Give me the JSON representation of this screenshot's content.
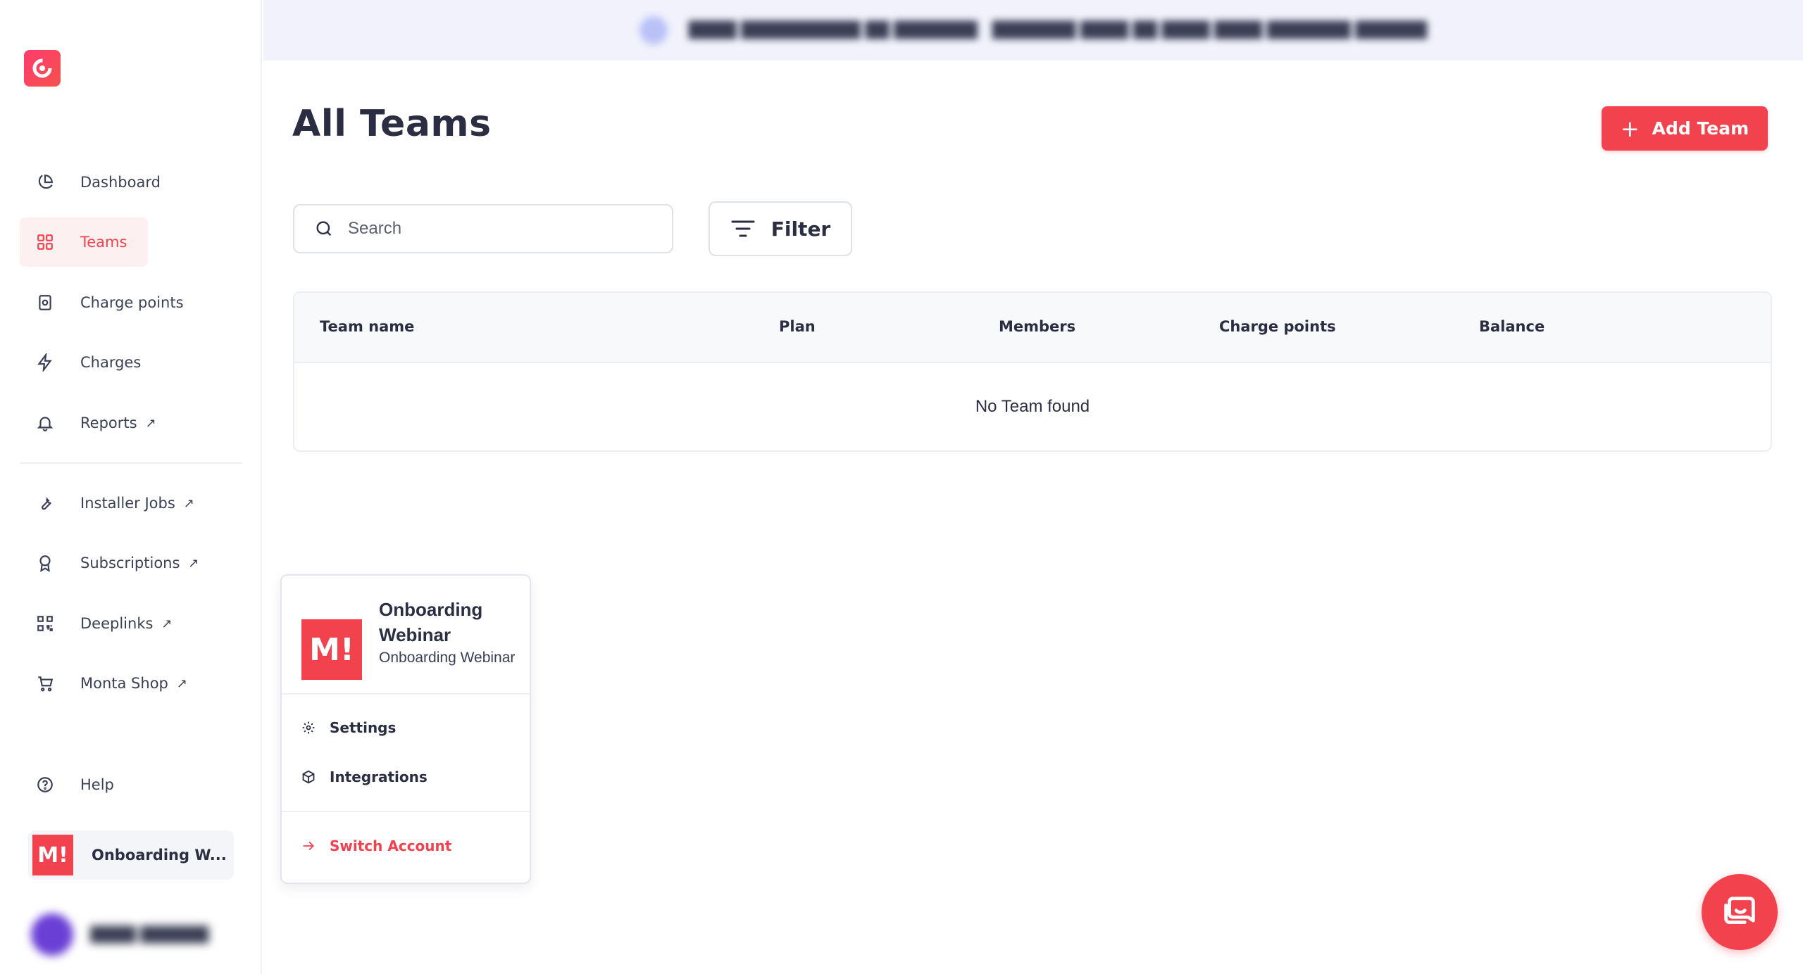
{
  "sidebar": {
    "items": [
      {
        "label": "Dashboard",
        "icon": "pie-chart-icon"
      },
      {
        "label": "Teams",
        "icon": "grid-icon",
        "active": true
      },
      {
        "label": "Charge points",
        "icon": "charger-icon"
      },
      {
        "label": "Charges",
        "icon": "bolt-icon"
      },
      {
        "label": "Reports",
        "icon": "bell-icon",
        "external": true
      },
      {
        "label": "Installer Jobs",
        "icon": "wrench-icon",
        "external": true
      },
      {
        "label": "Subscriptions",
        "icon": "award-icon",
        "external": true
      },
      {
        "label": "Deeplinks",
        "icon": "qr-code-icon",
        "external": true
      },
      {
        "label": "Monta Shop",
        "icon": "cart-icon",
        "external": true
      },
      {
        "label": "Help",
        "icon": "help-circle-icon"
      }
    ],
    "external_glyph": "↗",
    "account_chip": {
      "logo_text": "M!",
      "label": "Onboarding W..."
    }
  },
  "header": {
    "title": "All Teams",
    "add_button": {
      "icon": "+",
      "label": "Add Team"
    }
  },
  "search": {
    "placeholder": "Search",
    "value": ""
  },
  "filter": {
    "label": "Filter"
  },
  "table": {
    "columns": [
      "Team name",
      "Plan",
      "Members",
      "Charge points",
      "Balance"
    ],
    "rows": [],
    "empty_message": "No Team found"
  },
  "popover": {
    "logo_text": "M!",
    "name": "Onboarding Webinar",
    "subtitle": "Onboarding Webinar",
    "items": [
      {
        "label": "Settings",
        "icon": "gear-icon"
      },
      {
        "label": "Integrations",
        "icon": "cube-icon"
      }
    ],
    "switch_label": "Switch Account"
  },
  "colors": {
    "accent": "#f2424d",
    "active_bg": "#fdf0f0",
    "text": "#2b2d42",
    "banner_bg": "#f1f2fc"
  }
}
